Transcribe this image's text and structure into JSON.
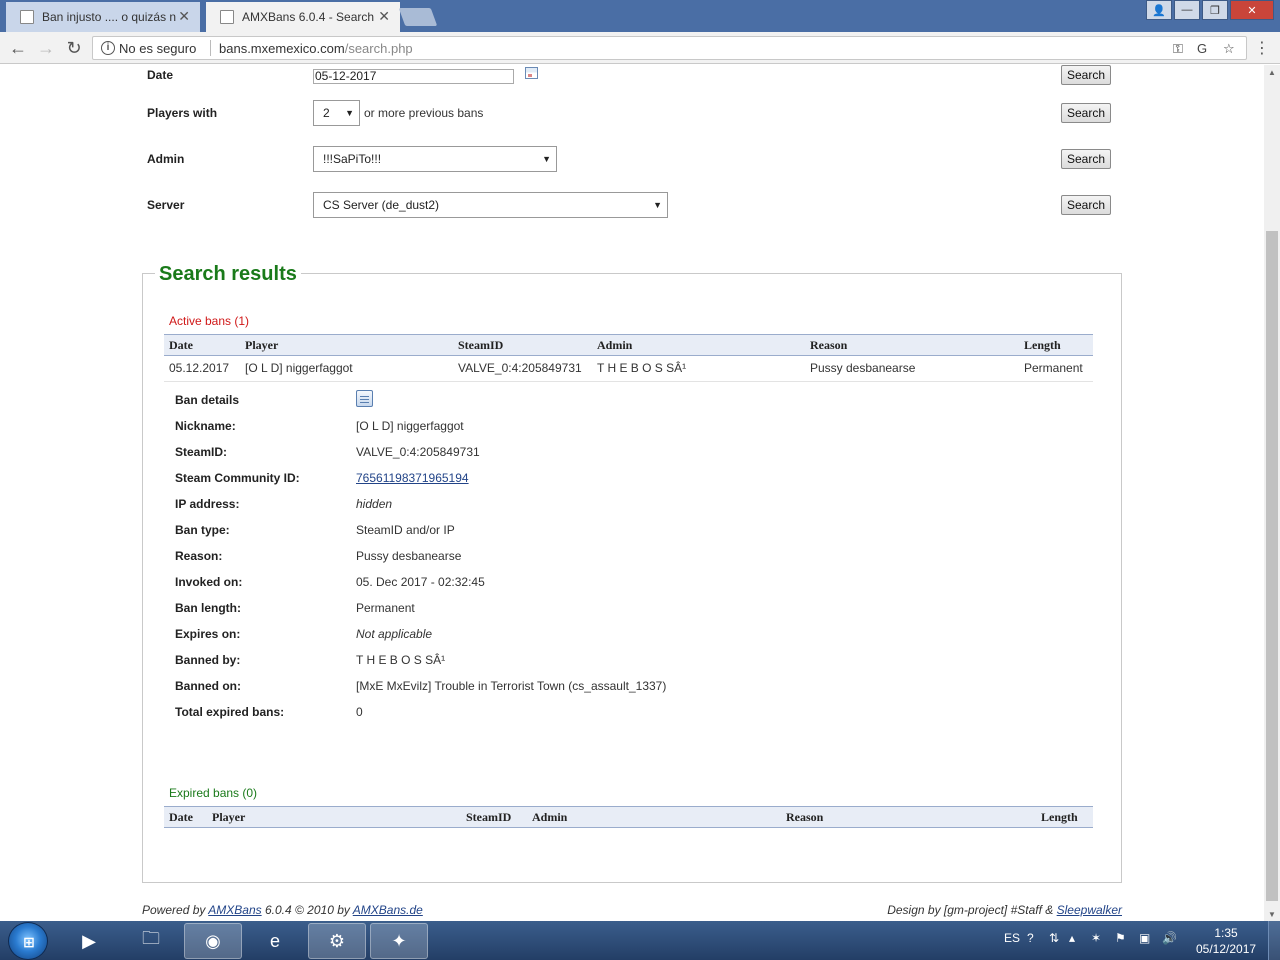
{
  "browser": {
    "tabs": [
      {
        "title": "Ban injusto .... o quizás n",
        "active": false
      },
      {
        "title": "AMXBans 6.0.4 - Search",
        "active": true
      }
    ],
    "security_label": "No es seguro",
    "url_domain": "bans.mxemexico.com",
    "url_path": "/search.php"
  },
  "search_form": {
    "date_label": "Date",
    "date_value": "05-12-2017",
    "players_label": "Players with",
    "players_value": "2",
    "players_suffix": "or more previous bans",
    "admin_label": "Admin",
    "admin_value": "!!!SaPiTo!!!",
    "server_label": "Server",
    "server_value": "CS Server (de_dust2)",
    "search_button": "Search"
  },
  "results": {
    "title": "Search results",
    "active_title": "Active bans (1)",
    "columns": [
      "Date",
      "Player",
      "SteamID",
      "Admin",
      "Reason",
      "Length"
    ],
    "row": {
      "date": "05.12.2017",
      "player": "[O L D] niggerfaggot",
      "steamid": "VALVE_0:4:205849731",
      "admin": "T H E B O S SÂ¹",
      "reason": "Pussy desbanearse",
      "length": "Permanent"
    },
    "details": [
      {
        "label": "Ban details",
        "value": ""
      },
      {
        "label": "Nickname:",
        "value": "[O L D] niggerfaggot"
      },
      {
        "label": "SteamID:",
        "value": "VALVE_0:4:205849731"
      },
      {
        "label": "Steam Community ID:",
        "value": "76561198371965194"
      },
      {
        "label": "IP address:",
        "value": "hidden"
      },
      {
        "label": "Ban type:",
        "value": "SteamID and/or IP"
      },
      {
        "label": "Reason:",
        "value": "Pussy desbanearse"
      },
      {
        "label": "Invoked on:",
        "value": "05. Dec 2017 - 02:32:45"
      },
      {
        "label": "Ban length:",
        "value": "Permanent"
      },
      {
        "label": "Expires on:",
        "value": "Not applicable"
      },
      {
        "label": "Banned by:",
        "value": "T H E B O S SÂ¹"
      },
      {
        "label": "Banned on:",
        "value": "[MxE MxEvilz] Trouble in Terrorist Town (cs_assault_1337)"
      },
      {
        "label": "Total expired bans:",
        "value": "0"
      }
    ],
    "expired_title": "Expired bans (0)"
  },
  "footer": {
    "powered_prefix": "Powered by",
    "amxbans_link": "AMXBans",
    "powered_middle": "6.0.4 © 2010 by",
    "amxbans_de_link": "AMXBans.de",
    "design_prefix": "Design by [gm-project] #Staff &",
    "design_link": "Sleepwalker"
  },
  "taskbar": {
    "language": "ES",
    "time": "1:35",
    "date": "05/12/2017"
  }
}
